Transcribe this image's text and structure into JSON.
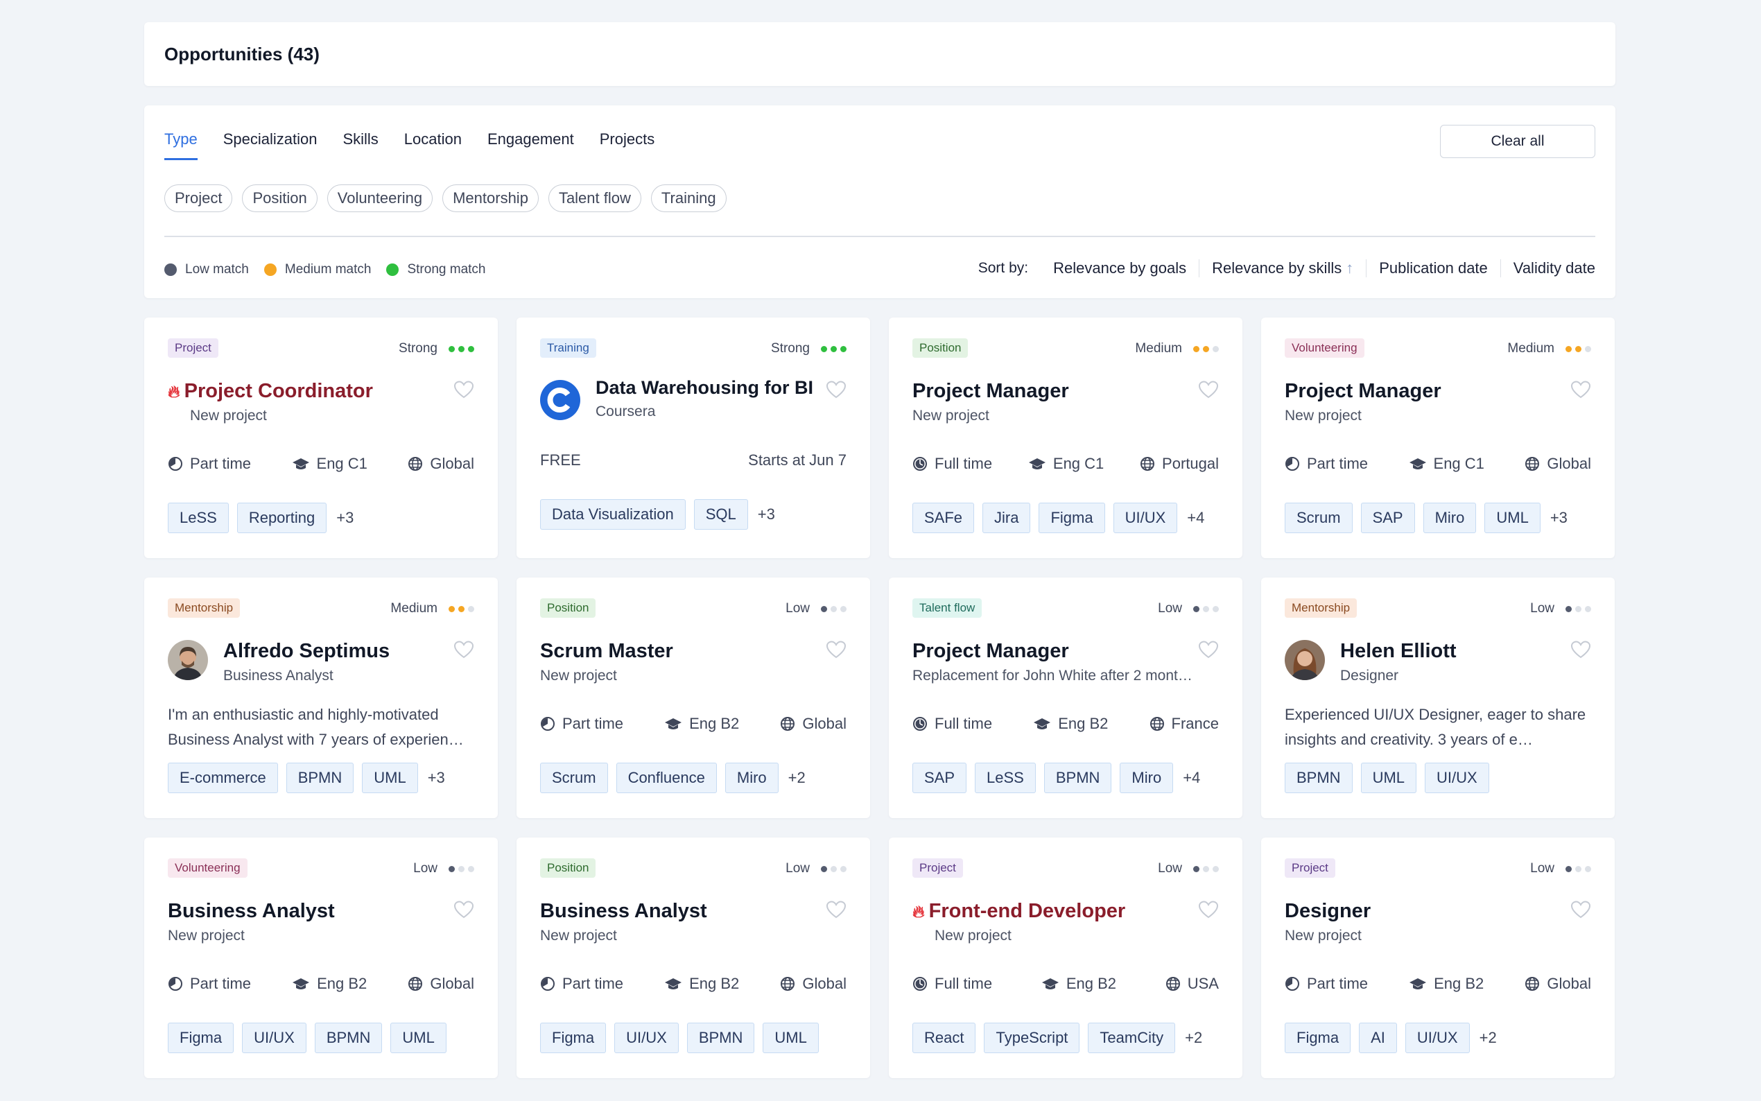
{
  "header": {
    "title": "Opportunities (43)"
  },
  "filters": {
    "tabs": [
      "Type",
      "Specialization",
      "Skills",
      "Location",
      "Engagement",
      "Projects"
    ],
    "clear_all": "Clear all",
    "chips": [
      "Project",
      "Position",
      "Volunteering",
      "Mentorship",
      "Talent flow",
      "Training"
    ],
    "legend": [
      {
        "label": "Low match",
        "color": "#545b6e"
      },
      {
        "label": "Medium match",
        "color": "#f5a623"
      },
      {
        "label": "Strong match",
        "color": "#2fbf3f"
      }
    ],
    "sort_label": "Sort by:",
    "sort_options": [
      "Relevance by goals",
      "Relevance by skills",
      "Publication date",
      "Validity date"
    ]
  },
  "colors": {
    "low": "#545b6e",
    "medium": "#f5a623",
    "strong": "#2fbf3f",
    "hot": "#e5353c",
    "accent": "#2f6fe0"
  },
  "cards": [
    {
      "type_label": "Project",
      "match": "Strong",
      "title": "Project Coordinator",
      "subtitle": "New project",
      "meta": [
        "Part time",
        "Eng C1",
        "Global"
      ],
      "skills": [
        "LeSS",
        "Reporting"
      ],
      "more": "+3"
    },
    {
      "type_label": "Training",
      "match": "Strong",
      "title": "Data Warehousing for BI",
      "subtitle": "Coursera",
      "price": "FREE",
      "starts": "Starts at Jun 7",
      "skills": [
        "Data Visualization",
        "SQL"
      ],
      "more": "+3"
    },
    {
      "type_label": "Position",
      "match": "Medium",
      "title": "Project Manager",
      "subtitle": "New project",
      "meta": [
        "Full time",
        "Eng C1",
        "Portugal"
      ],
      "skills": [
        "SAFe",
        "Jira",
        "Figma",
        "UI/UX"
      ],
      "more": "+4"
    },
    {
      "type_label": "Volunteering",
      "match": "Medium",
      "title": "Project Manager",
      "subtitle": "New project",
      "meta": [
        "Part time",
        "Eng C1",
        "Global"
      ],
      "skills": [
        "Scrum",
        "SAP",
        "Miro",
        "UML"
      ],
      "more": "+3"
    },
    {
      "type_label": "Mentorship",
      "match": "Medium",
      "title": "Alfredo Septimus",
      "subtitle": "Business Analyst",
      "desc": "I'm an enthusiastic and highly-motivated Business Analyst with 7 years of experien…",
      "skills": [
        "E-commerce",
        "BPMN",
        "UML"
      ],
      "more": "+3"
    },
    {
      "type_label": "Position",
      "match": "Low",
      "title": "Scrum Master",
      "subtitle": "New project",
      "meta": [
        "Part time",
        "Eng B2",
        "Global"
      ],
      "skills": [
        "Scrum",
        "Confluence",
        "Miro"
      ],
      "more": "+2"
    },
    {
      "type_label": "Talent flow",
      "match": "Low",
      "title": "Project Manager",
      "subtitle": "Replacement for John White after 2 mont…",
      "meta": [
        "Full time",
        "Eng B2",
        "France"
      ],
      "skills": [
        "SAP",
        "LeSS",
        "BPMN",
        "Miro"
      ],
      "more": "+4"
    },
    {
      "type_label": "Mentorship",
      "match": "Low",
      "title": "Helen Elliott",
      "subtitle": "Designer",
      "desc": "Experienced UI/UX Designer, eager to share insights and creativity. 3 years of e…",
      "skills": [
        "BPMN",
        "UML",
        "UI/UX"
      ],
      "more": ""
    },
    {
      "type_label": "Volunteering",
      "match": "Low",
      "title": "Business Analyst",
      "subtitle": "New project",
      "meta": [
        "Part time",
        "Eng B2",
        "Global"
      ],
      "skills": [
        "Figma",
        "UI/UX",
        "BPMN",
        "UML"
      ],
      "more": ""
    },
    {
      "type_label": "Position",
      "match": "Low",
      "title": "Business Analyst",
      "subtitle": "New project",
      "meta": [
        "Part time",
        "Eng B2",
        "Global"
      ],
      "skills": [
        "Figma",
        "UI/UX",
        "BPMN",
        "UML"
      ],
      "more": ""
    },
    {
      "type_label": "Project",
      "match": "Low",
      "title": "Front-end Developer",
      "subtitle": "New project",
      "meta": [
        "Full time",
        "Eng B2",
        "USA"
      ],
      "skills": [
        "React",
        "TypeScript",
        "TeamCity"
      ],
      "more": "+2"
    },
    {
      "type_label": "Project",
      "match": "Low",
      "title": "Designer",
      "subtitle": "New project",
      "meta": [
        "Part time",
        "Eng B2",
        "Global"
      ],
      "skills": [
        "Figma",
        "AI",
        "UI/UX"
      ],
      "more": "+2"
    }
  ]
}
